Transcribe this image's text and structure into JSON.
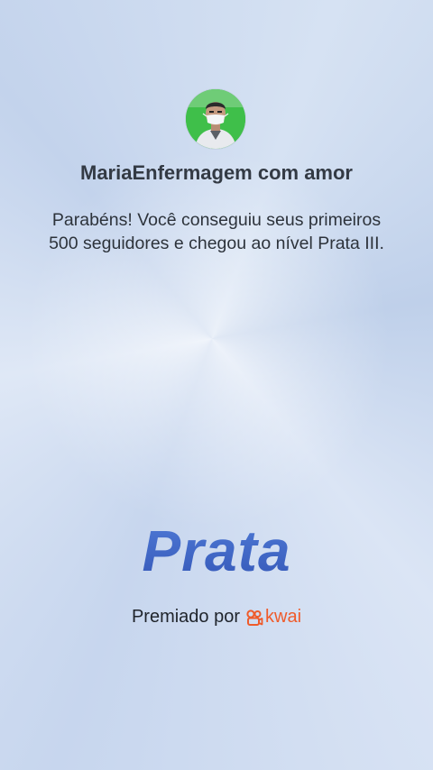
{
  "profile": {
    "username": "MariaEnfermagem com amor",
    "avatar_icon": "person-with-mask-avatar"
  },
  "message": "Parabéns! Você conseguiu seus primeiros 500 seguidores e chegou ao nível Prata III.",
  "level": {
    "title": "Prata"
  },
  "footer": {
    "awarded_by": "Premiado por",
    "brand_name": "kwai",
    "brand_icon": "kwai-logo-icon",
    "brand_color": "#ef5b2b"
  },
  "colors": {
    "level_text": "#3d64c4",
    "avatar_bg": "#3fbf4a"
  }
}
